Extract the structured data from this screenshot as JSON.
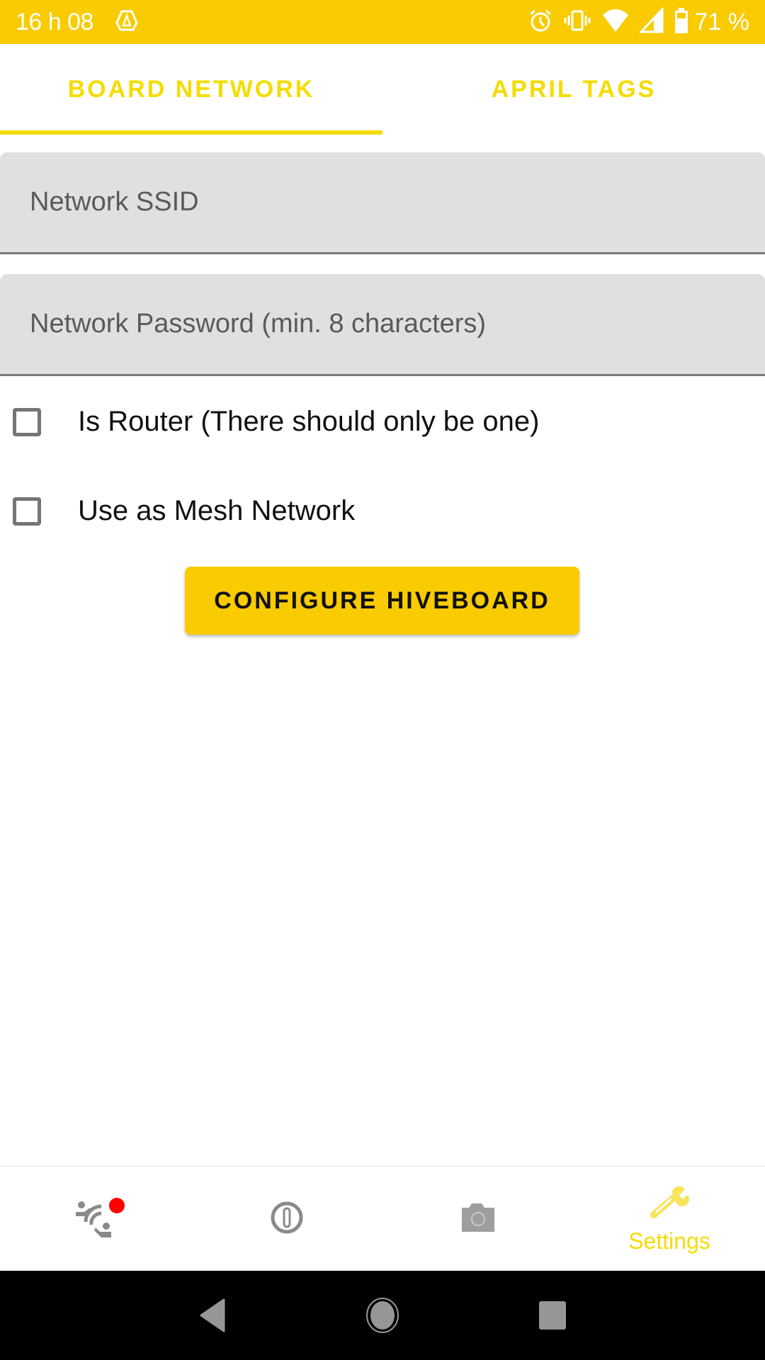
{
  "status_bar": {
    "time": "16 h 08",
    "battery_percent": "71 %",
    "icons": [
      "app-notification-icon",
      "alarm-icon",
      "vibrate-icon",
      "wifi-icon",
      "cell-signal-icon",
      "battery-icon"
    ]
  },
  "tabs": [
    {
      "label": "BOARD NETWORK",
      "active": true
    },
    {
      "label": "APRIL TAGS",
      "active": false
    }
  ],
  "form": {
    "ssid": {
      "placeholder": "Network SSID",
      "value": ""
    },
    "password": {
      "placeholder": "Network Password (min. 8 characters)",
      "value": ""
    },
    "checkboxes": [
      {
        "label": "Is Router (There should only be one)",
        "checked": false
      },
      {
        "label": "Use as Mesh Network",
        "checked": false
      }
    ],
    "configure_button": "CONFIGURE HIVEBOARD"
  },
  "bottom_nav": {
    "items": [
      {
        "icon": "connect-users-icon",
        "label": "",
        "badge": true
      },
      {
        "icon": "info-icon",
        "label": ""
      },
      {
        "icon": "camera-icon",
        "label": ""
      },
      {
        "icon": "wrench-icon",
        "label": "Settings",
        "active": true
      }
    ]
  },
  "colors": {
    "accent": "#F9CB00",
    "tab_active": "#F5DC00",
    "badge": "#FF0000",
    "icon_inactive": "#8A8A8A"
  }
}
